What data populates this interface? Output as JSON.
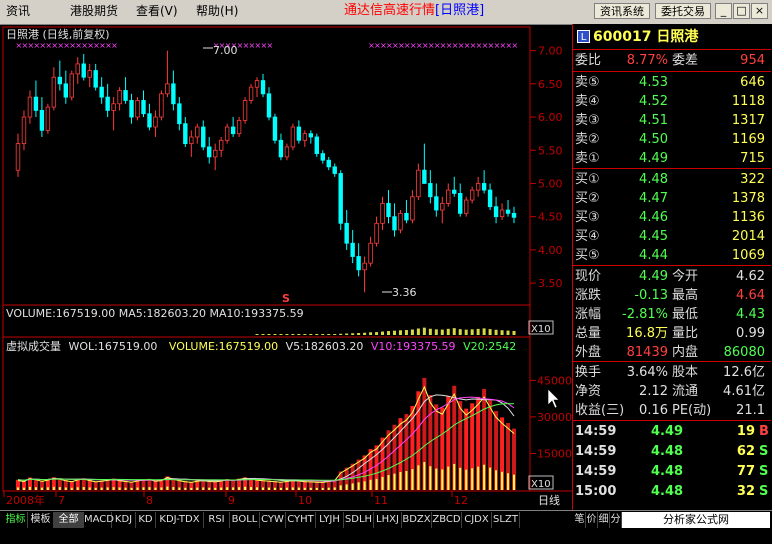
{
  "menu": {
    "items": [
      "资讯",
      "港股期货",
      "查看(V)",
      "帮助(H)"
    ],
    "app_title_prefix": "通达信高速行情",
    "app_title_stock": "[日照港]",
    "btn_info": "资讯系统",
    "btn_trade": "委托交易"
  },
  "chart": {
    "header": "日照港 (日线,前复权)",
    "high_label": "7.00",
    "low_label": "3.36",
    "s_marker": "S",
    "volume_text": "VOLUME:167519.00 MA5:182603.20 MA10:193375.59",
    "ind_name": "虚拟成交量",
    "ind_wol": "WOL:167519.00",
    "ind_volume": "VOLUME:167519.00",
    "ind_v5": "V5:182603.20",
    "ind_v10": "V10:193375.59",
    "ind_v20": "V20:2542",
    "x10": "X10",
    "period": "日线",
    "colors": {
      "up": "#ff3c3c",
      "down": "#00ffff",
      "yellow": "#ffff54",
      "magenta": "#ff44ff",
      "green": "#50ff50",
      "axis": "#c00000"
    }
  },
  "chart_data": {
    "type": "candlestick",
    "title": "日照港 (日线,前复权)",
    "price_axis": {
      "ticks": [
        7.0,
        6.5,
        6.0,
        5.5,
        5.0,
        4.5,
        4.0,
        3.5
      ],
      "ylim": [
        3.2,
        7.1
      ]
    },
    "x_labels": [
      "2008年",
      "7",
      "8",
      "9",
      "10",
      "11",
      "12"
    ],
    "candles": [
      [
        5.2,
        5.75,
        5.1,
        5.6
      ],
      [
        5.6,
        6.1,
        5.5,
        6.0
      ],
      [
        6.0,
        6.4,
        5.9,
        6.3
      ],
      [
        6.3,
        6.55,
        6.0,
        6.1
      ],
      [
        6.1,
        6.3,
        5.7,
        5.8
      ],
      [
        5.8,
        6.2,
        5.75,
        6.15
      ],
      [
        6.15,
        6.75,
        6.1,
        6.6
      ],
      [
        6.6,
        6.85,
        6.4,
        6.5
      ],
      [
        6.5,
        6.7,
        6.2,
        6.3
      ],
      [
        6.3,
        6.7,
        6.25,
        6.65
      ],
      [
        6.65,
        6.9,
        6.5,
        6.8
      ],
      [
        6.8,
        6.95,
        6.55,
        6.6
      ],
      [
        6.6,
        6.8,
        6.45,
        6.7
      ],
      [
        6.7,
        6.8,
        6.4,
        6.45
      ],
      [
        6.45,
        6.6,
        6.2,
        6.3
      ],
      [
        6.3,
        6.5,
        6.0,
        6.1
      ],
      [
        6.1,
        6.3,
        5.8,
        6.2
      ],
      [
        6.2,
        6.45,
        6.1,
        6.4
      ],
      [
        6.4,
        6.6,
        6.2,
        6.25
      ],
      [
        6.25,
        6.35,
        5.9,
        6.0
      ],
      [
        6.0,
        6.3,
        5.95,
        6.25
      ],
      [
        6.25,
        6.4,
        6.0,
        6.05
      ],
      [
        6.05,
        6.2,
        5.8,
        5.85
      ],
      [
        5.85,
        6.1,
        5.7,
        6.0
      ],
      [
        6.0,
        6.4,
        5.95,
        6.35
      ],
      [
        6.35,
        7.0,
        6.3,
        6.5
      ],
      [
        6.5,
        6.7,
        6.1,
        6.2
      ],
      [
        6.2,
        6.3,
        5.8,
        5.9
      ],
      [
        5.9,
        6.0,
        5.55,
        5.6
      ],
      [
        5.6,
        5.8,
        5.4,
        5.7
      ],
      [
        5.7,
        5.9,
        5.6,
        5.85
      ],
      [
        5.85,
        5.95,
        5.5,
        5.55
      ],
      [
        5.55,
        5.7,
        5.3,
        5.4
      ],
      [
        5.4,
        5.6,
        5.2,
        5.5
      ],
      [
        5.5,
        5.7,
        5.4,
        5.65
      ],
      [
        5.65,
        5.9,
        5.6,
        5.85
      ],
      [
        5.85,
        6.0,
        5.7,
        5.75
      ],
      [
        5.75,
        6.0,
        5.7,
        5.95
      ],
      [
        5.95,
        6.3,
        5.9,
        6.25
      ],
      [
        6.25,
        6.5,
        6.2,
        6.45
      ],
      [
        6.45,
        6.6,
        6.3,
        6.55
      ],
      [
        6.55,
        6.65,
        6.3,
        6.35
      ],
      [
        6.35,
        6.45,
        5.95,
        6.0
      ],
      [
        6.0,
        6.05,
        5.6,
        5.65
      ],
      [
        5.65,
        5.75,
        5.35,
        5.4
      ],
      [
        5.4,
        5.6,
        5.35,
        5.55
      ],
      [
        5.55,
        5.9,
        5.5,
        5.85
      ],
      [
        5.85,
        5.95,
        5.6,
        5.65
      ],
      [
        5.65,
        5.8,
        5.55,
        5.75
      ],
      [
        5.75,
        5.8,
        5.6,
        5.7
      ],
      [
        5.7,
        5.75,
        5.4,
        5.45
      ],
      [
        5.45,
        5.5,
        5.3,
        5.35
      ],
      [
        5.35,
        5.4,
        5.2,
        5.25
      ],
      [
        5.25,
        5.3,
        5.1,
        5.15
      ],
      [
        5.15,
        5.2,
        4.3,
        4.4
      ],
      [
        4.4,
        4.6,
        4.0,
        4.1
      ],
      [
        4.1,
        4.3,
        3.8,
        3.9
      ],
      [
        3.9,
        4.1,
        3.6,
        3.7
      ],
      [
        3.7,
        3.9,
        3.36,
        3.8
      ],
      [
        3.8,
        4.2,
        3.75,
        4.1
      ],
      [
        4.1,
        4.5,
        4.05,
        4.4
      ],
      [
        4.4,
        4.8,
        4.3,
        4.7
      ],
      [
        4.7,
        4.9,
        4.4,
        4.5
      ],
      [
        4.5,
        4.7,
        4.2,
        4.3
      ],
      [
        4.3,
        4.6,
        4.25,
        4.55
      ],
      [
        4.55,
        4.75,
        4.4,
        4.45
      ],
      [
        4.45,
        4.9,
        4.4,
        4.8
      ],
      [
        4.8,
        5.3,
        4.75,
        5.2
      ],
      [
        5.2,
        5.6,
        5.1,
        5.0
      ],
      [
        5.0,
        5.2,
        4.7,
        4.8
      ],
      [
        4.8,
        5.0,
        4.5,
        4.6
      ],
      [
        4.6,
        4.8,
        4.4,
        4.7
      ],
      [
        4.7,
        5.0,
        4.65,
        4.9
      ],
      [
        4.9,
        5.1,
        4.8,
        4.85
      ],
      [
        4.85,
        5.0,
        4.5,
        4.55
      ],
      [
        4.55,
        4.8,
        4.5,
        4.75
      ],
      [
        4.75,
        4.95,
        4.7,
        4.9
      ],
      [
        4.9,
        5.1,
        4.8,
        5.0
      ],
      [
        5.0,
        5.2,
        4.85,
        4.9
      ],
      [
        4.9,
        5.0,
        4.6,
        4.65
      ],
      [
        4.65,
        4.8,
        4.4,
        4.5
      ],
      [
        4.5,
        4.7,
        4.45,
        4.6
      ],
      [
        4.6,
        4.75,
        4.5,
        4.55
      ],
      [
        4.55,
        4.65,
        4.4,
        4.49
      ]
    ],
    "volume_axis": {
      "ticks": [
        45000,
        30000,
        15000
      ],
      "ylim": [
        0,
        55000
      ]
    },
    "volumes": [
      4200,
      3800,
      5100,
      4600,
      3900,
      4400,
      5200,
      4800,
      4100,
      3700,
      4500,
      4900,
      4200,
      3600,
      3900,
      4300,
      4700,
      4100,
      3800,
      3500,
      4000,
      4400,
      4600,
      3900,
      4200,
      5600,
      4800,
      4100,
      3700,
      3400,
      3900,
      4200,
      3800,
      3600,
      4000,
      4500,
      4300,
      4700,
      5200,
      4800,
      4400,
      4100,
      3900,
      3700,
      3500,
      3800,
      4200,
      4000,
      3700,
      3600,
      3500,
      3400,
      3800,
      4200,
      7600,
      9200,
      10800,
      12500,
      14200,
      16800,
      18300,
      21500,
      24500,
      26800,
      29500,
      31200,
      34500,
      40500,
      46000,
      39000,
      35200,
      33800,
      38500,
      42800,
      36500,
      33400,
      35600,
      38200,
      41500,
      36800,
      32400,
      29800,
      27500,
      25200
    ],
    "series": [
      {
        "name": "VOLUME",
        "values": []
      },
      {
        "name": "V5",
        "values": []
      },
      {
        "name": "V10",
        "values": []
      },
      {
        "name": "V20",
        "values": []
      }
    ]
  },
  "quote": {
    "code": "600017",
    "name": "日照港",
    "badge": "L",
    "weibi_label": "委比",
    "weibi": "8.77%",
    "weicha_label": "委差",
    "weicha": "954",
    "asks": [
      {
        "label": "卖⑤",
        "price": "4.53",
        "vol": "646"
      },
      {
        "label": "卖④",
        "price": "4.52",
        "vol": "1118"
      },
      {
        "label": "卖③",
        "price": "4.51",
        "vol": "1317"
      },
      {
        "label": "卖②",
        "price": "4.50",
        "vol": "1169"
      },
      {
        "label": "卖①",
        "price": "4.49",
        "vol": "715"
      }
    ],
    "bids": [
      {
        "label": "买①",
        "price": "4.48",
        "vol": "322"
      },
      {
        "label": "买②",
        "price": "4.47",
        "vol": "1378"
      },
      {
        "label": "买③",
        "price": "4.46",
        "vol": "1136"
      },
      {
        "label": "买④",
        "price": "4.45",
        "vol": "2014"
      },
      {
        "label": "买⑤",
        "price": "4.44",
        "vol": "1069"
      }
    ],
    "stats1": [
      {
        "l1": "现价",
        "v1": "4.49",
        "c1": "#50ff50",
        "l2": "今开",
        "v2": "4.62",
        "c2": "#e0e0e0"
      },
      {
        "l1": "涨跌",
        "v1": "-0.13",
        "c1": "#50ff50",
        "l2": "最高",
        "v2": "4.64",
        "c2": "#ff4040"
      },
      {
        "l1": "涨幅",
        "v1": "-2.81%",
        "c1": "#50ff50",
        "l2": "最低",
        "v2": "4.43",
        "c2": "#50ff50"
      },
      {
        "l1": "总量",
        "v1": "16.8万",
        "c1": "#ffff54",
        "l2": "量比",
        "v2": "0.99",
        "c2": "#e0e0e0"
      },
      {
        "l1": "外盘",
        "v1": "81439",
        "c1": "#ff4040",
        "l2": "内盘",
        "v2": "86080",
        "c2": "#50ff50"
      }
    ],
    "stats2": [
      {
        "l1": "换手",
        "v1": "3.64%",
        "c1": "#e0e0e0",
        "l2": "股本",
        "v2": "12.6亿",
        "c2": "#e0e0e0"
      },
      {
        "l1": "净资",
        "v1": "2.12",
        "c1": "#e0e0e0",
        "l2": "流通",
        "v2": "4.61亿",
        "c2": "#e0e0e0"
      },
      {
        "l1": "收益(三)",
        "v1": "0.16",
        "c1": "#e0e0e0",
        "l2": "PE(动)",
        "v2": "21.1",
        "c2": "#e0e0e0"
      }
    ],
    "ticks": [
      {
        "time": "14:59",
        "price": "4.49",
        "vol": "19",
        "dir": "B",
        "dc": "#ff4040"
      },
      {
        "time": "14:59",
        "price": "4.48",
        "vol": "62",
        "dir": "S",
        "dc": "#50ff50"
      },
      {
        "time": "14:59",
        "price": "4.48",
        "vol": "77",
        "dir": "S",
        "dc": "#50ff50"
      },
      {
        "time": "15:00",
        "price": "4.48",
        "vol": "32",
        "dir": "S",
        "dc": "#50ff50"
      }
    ]
  },
  "tabs": [
    "指标",
    "模板",
    "全部",
    "MACD",
    "KDJ",
    "KD",
    "KDJ-TDX",
    "RSI",
    "BOLL",
    "CYW",
    "CYHT",
    "LYJH",
    "SDLH",
    "LHXJ",
    "BDZX",
    "ZBCD",
    "CJDX",
    "SLZT"
  ],
  "tabs_right": [
    "笔",
    "价",
    "细",
    "分"
  ],
  "brand": "分析家公式网 www.88gs.com"
}
